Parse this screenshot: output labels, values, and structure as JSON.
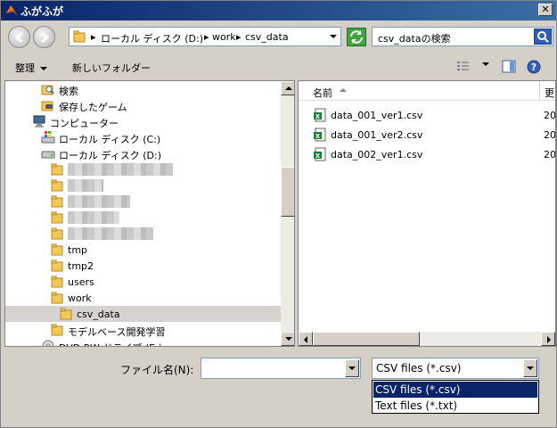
{
  "window": {
    "title": "ふがふが"
  },
  "address": {
    "breadcrumbs": [
      "ローカル ディスク (D:)",
      "work",
      "csv_data"
    ]
  },
  "search": {
    "placeholder": "csv_dataの検索"
  },
  "toolbar": {
    "organize_label": "整理",
    "new_folder_label": "新しいフォルダー"
  },
  "tree": {
    "items": [
      {
        "label": "検索",
        "icon": "search-folder-icon"
      },
      {
        "label": "保存したゲーム",
        "icon": "game-folder-icon"
      },
      {
        "label": "コンピューター",
        "icon": "computer-icon"
      },
      {
        "label": "ローカル ディスク (C:)",
        "icon": "system-drive-icon"
      },
      {
        "label": "ローカル ディスク (D:)",
        "icon": "drive-icon"
      },
      {
        "label": "",
        "icon": "folder-icon"
      },
      {
        "label": "",
        "icon": "folder-icon"
      },
      {
        "label": "",
        "icon": "folder-icon"
      },
      {
        "label": "",
        "icon": "folder-icon"
      },
      {
        "label": "",
        "icon": "folder-icon"
      },
      {
        "label": "tmp",
        "icon": "folder-icon"
      },
      {
        "label": "tmp2",
        "icon": "folder-icon"
      },
      {
        "label": "users",
        "icon": "folder-icon"
      },
      {
        "label": "work",
        "icon": "folder-icon"
      },
      {
        "label": "csv_data",
        "icon": "folder-icon"
      },
      {
        "label": "モデルベース開発学習",
        "icon": "folder-icon"
      },
      {
        "label": "DVD RW ドライブ (E:)",
        "icon": "dvd-drive-icon"
      }
    ]
  },
  "files": {
    "column_name": "名前",
    "column_date": "更",
    "items": [
      {
        "name": "data_001_ver1.csv",
        "date": "20"
      },
      {
        "name": "data_001_ver2.csv",
        "date": "20"
      },
      {
        "name": "data_002_ver1.csv",
        "date": "20"
      }
    ]
  },
  "filename": {
    "label": "ファイル名(N):",
    "value": ""
  },
  "filetype": {
    "selected": "CSV files (*.csv)",
    "options": [
      "CSV files (*.csv)",
      "Text files (*.txt)"
    ]
  },
  "colors": {
    "titlebar": "#0a246a",
    "selection": "#0a246a",
    "folder": "#f2c85a"
  }
}
